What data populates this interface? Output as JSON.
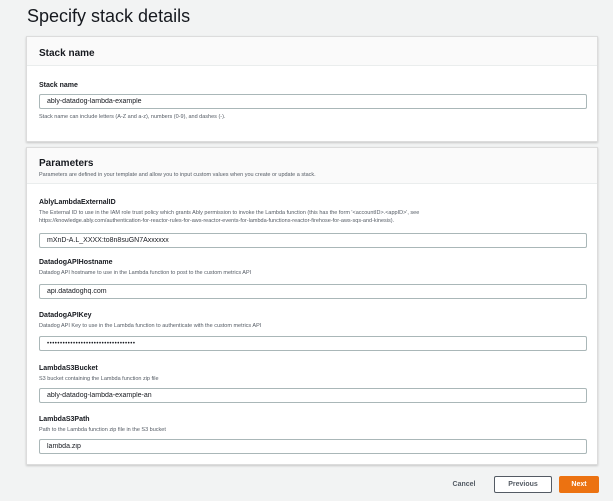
{
  "page": {
    "title": "Specify stack details"
  },
  "stack_name_panel": {
    "title": "Stack name",
    "field_label": "Stack name",
    "value": "ably-datadog-lambda-example",
    "hint": "Stack name can include letters (A-Z and a-z), numbers (0-9), and dashes (-)."
  },
  "parameters_panel": {
    "title": "Parameters",
    "description": "Parameters are defined in your template and allow you to input custom values when you create or update a stack.",
    "fields": [
      {
        "label": "AblyLambdaExternalID",
        "description": "The External ID to use in the IAM role trust policy which grants Ably permission to invoke the Lambda function (this has the form '<accountID>.<appID>', see",
        "description2": "https://knowledge.ably.com/authentication-for-reactor-rules-for-aws-reactor-events-for-lambda-functions-reactor-firehose-for-aws-sqs-and-kinesis).",
        "value": "mXnD-A.L_XXXX:to8n8suGN7Axxxxxx"
      },
      {
        "label": "DatadogAPIHostname",
        "description": "Datadog API hostname to use in the Lambda function to post to the custom metrics API",
        "value": "api.datadoghq.com"
      },
      {
        "label": "DatadogAPIKey",
        "description": "Datadog API Key to use in the Lambda function to authenticate with the custom metrics API",
        "value": "••••••••••••••••••••••••••••••••••"
      },
      {
        "label": "LambdaS3Bucket",
        "description": "S3 bucket containing the Lambda function zip file",
        "value": "ably-datadog-lambda-example-an"
      },
      {
        "label": "LambdaS3Path",
        "description": "Path to the Lambda function zip file in the S3 bucket",
        "value": "lambda.zip"
      }
    ]
  },
  "footer": {
    "cancel_label": "Cancel",
    "previous_label": "Previous",
    "next_label": "Next"
  },
  "colors": {
    "primary_button": "#ec7211",
    "background": "#f2f3f3",
    "panel": "#ffffff"
  }
}
